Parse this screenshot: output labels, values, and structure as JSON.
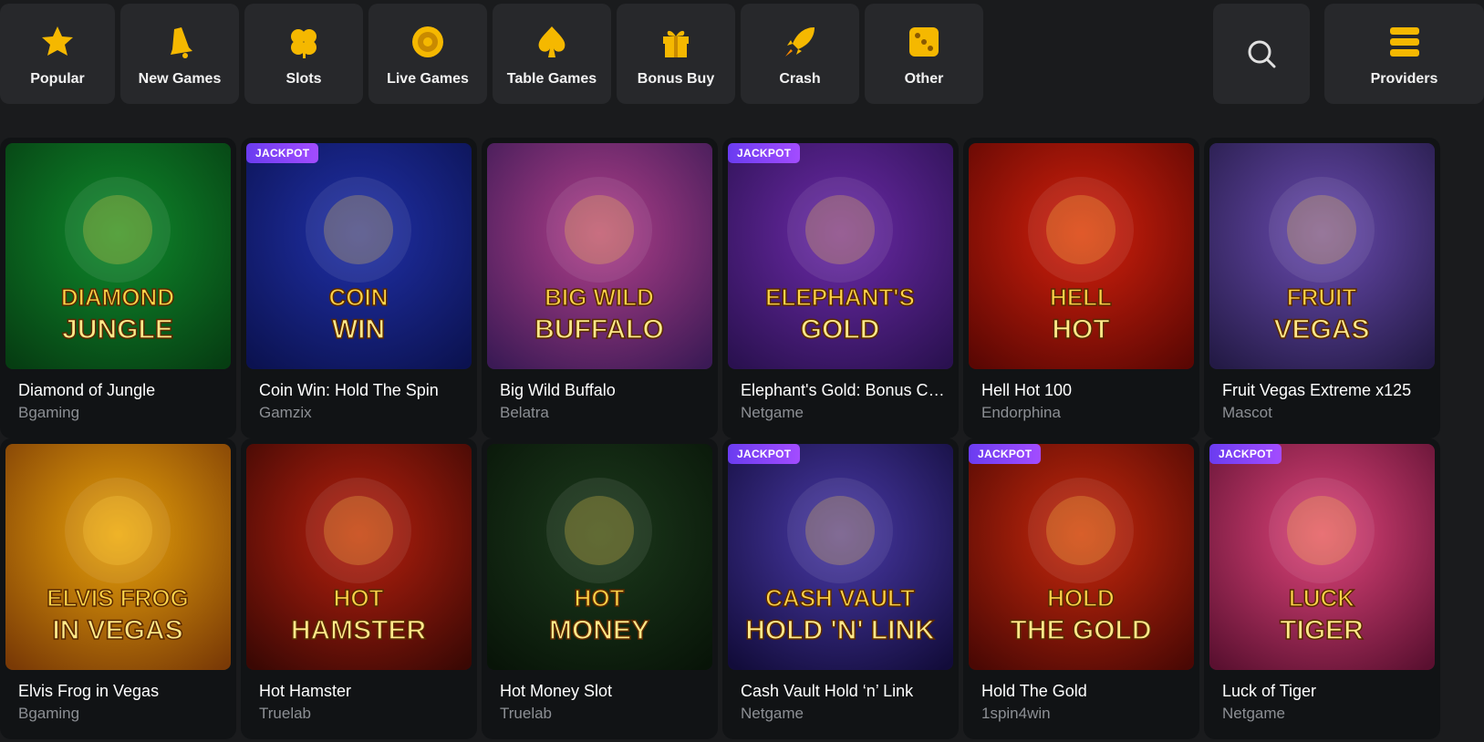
{
  "categories": [
    {
      "label": "Popular",
      "icon": "star-icon"
    },
    {
      "label": "New Games",
      "icon": "bell-icon"
    },
    {
      "label": "Slots",
      "icon": "clover-icon"
    },
    {
      "label": "Live Games",
      "icon": "roulette-icon"
    },
    {
      "label": "Table Games",
      "icon": "spade-icon"
    },
    {
      "label": "Bonus Buy",
      "icon": "gift-icon"
    },
    {
      "label": "Crash",
      "icon": "rocket-icon"
    },
    {
      "label": "Other",
      "icon": "dice-icon"
    }
  ],
  "search": {
    "icon": "search-icon"
  },
  "providers": {
    "label": "Providers",
    "icon": "stack-icon"
  },
  "accent_color": "#f5b800",
  "jackpot_label": "JACKPOT",
  "games": [
    {
      "title": "Diamond of Jungle",
      "provider": "Bgaming",
      "jackpot": false,
      "art": [
        "DIAMOND",
        "JUNGLE"
      ],
      "colors": [
        "#0f8a2c",
        "#063d12"
      ]
    },
    {
      "title": "Coin Win: Hold The Spin",
      "provider": "Gamzix",
      "jackpot": true,
      "art": [
        "COIN",
        "WIN"
      ],
      "colors": [
        "#2030a8",
        "#0b1250"
      ]
    },
    {
      "title": "Big Wild Buffalo",
      "provider": "Belatra",
      "jackpot": false,
      "art": [
        "BIG WILD",
        "BUFFALO"
      ],
      "colors": [
        "#b13f8a",
        "#3b1a55"
      ]
    },
    {
      "title": "Elephant's Gold: Bonus Combo",
      "provider": "Netgame",
      "jackpot": true,
      "art": [
        "ELEPHANT'S",
        "GOLD"
      ],
      "colors": [
        "#6c2aa8",
        "#2a1150"
      ]
    },
    {
      "title": "Hell Hot 100",
      "provider": "Endorphina",
      "jackpot": false,
      "art": [
        "HELL",
        "HOT"
      ],
      "colors": [
        "#d4200c",
        "#5a0703"
      ]
    },
    {
      "title": "Fruit Vegas Extreme x125",
      "provider": "Mascot",
      "jackpot": false,
      "art": [
        "FRUIT",
        "VEGAS"
      ],
      "colors": [
        "#6a4bb0",
        "#231a45"
      ]
    },
    {
      "title": "Elvis Frog in Vegas",
      "provider": "Bgaming",
      "jackpot": false,
      "art": [
        "ELVIS FROG",
        "IN VEGAS"
      ],
      "colors": [
        "#e8a20a",
        "#7a3a06"
      ]
    },
    {
      "title": "Hot Hamster",
      "provider": "Truelab",
      "jackpot": false,
      "art": [
        "HOT",
        "HAMSTER"
      ],
      "colors": [
        "#b8200e",
        "#3a0804"
      ]
    },
    {
      "title": "Hot Money Slot",
      "provider": "Truelab",
      "jackpot": false,
      "art": [
        "HOT",
        "MONEY"
      ],
      "colors": [
        "#1c3a1c",
        "#081408"
      ]
    },
    {
      "title": "Cash Vault Hold ‘n’ Link",
      "provider": "Netgame",
      "jackpot": true,
      "art": [
        "CASH VAULT",
        "HOLD 'N' LINK"
      ],
      "colors": [
        "#4a3aa8",
        "#120c3a"
      ]
    },
    {
      "title": "Hold The Gold",
      "provider": "1spin4win",
      "jackpot": true,
      "art": [
        "HOLD",
        "THE GOLD"
      ],
      "colors": [
        "#c8280c",
        "#4a0804"
      ]
    },
    {
      "title": "Luck of Tiger",
      "provider": "Netgame",
      "jackpot": true,
      "art": [
        "LUCK",
        "TIGER"
      ],
      "colors": [
        "#e0447a",
        "#5a1030"
      ]
    }
  ]
}
